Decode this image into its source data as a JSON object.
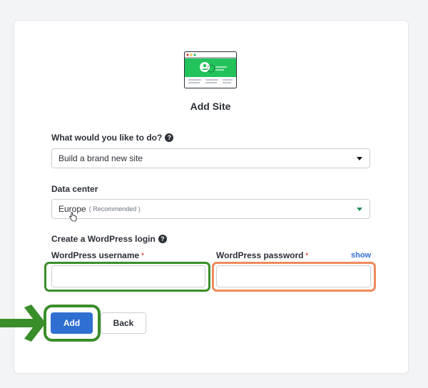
{
  "form": {
    "title": "Add Site",
    "action": {
      "label": "What would you like to do?",
      "selected": "Build a brand new site"
    },
    "datacenter": {
      "label": "Data center",
      "selected": "Europe",
      "note": "( Recommended )"
    },
    "login": {
      "label": "Create a WordPress login",
      "username_label": "WordPress username",
      "password_label": "WordPress password",
      "required_mark": "*",
      "show_link": "show",
      "username_value": "",
      "password_value": ""
    },
    "buttons": {
      "add": "Add",
      "back": "Back"
    }
  },
  "colors": {
    "primary": "#2f6fd1",
    "highlight_green": "#3a8e2a",
    "highlight_orange": "#ef8a5a",
    "illustration_green": "#21c35a"
  },
  "icons": {
    "help": "question-circle",
    "select_caret": "caret-down",
    "annotation_arrow": "arrow-right",
    "cursor": "hand-pointer"
  }
}
